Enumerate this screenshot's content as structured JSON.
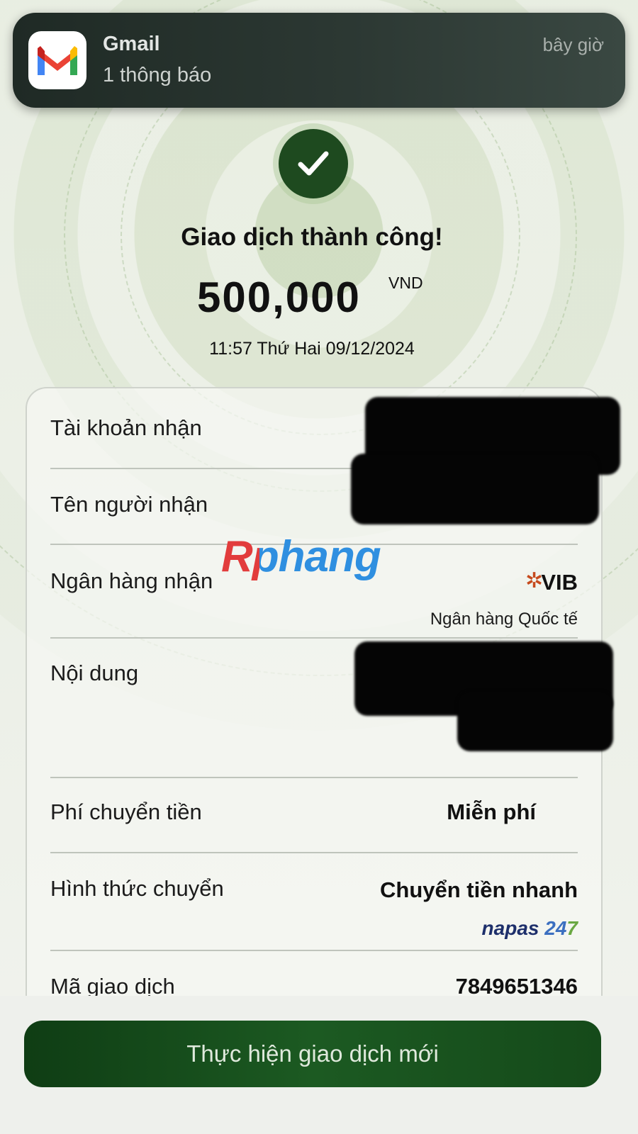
{
  "notification": {
    "app": "Gmail",
    "message": "1 thông báo",
    "time": "bây giờ",
    "icon": "gmail-icon"
  },
  "status": {
    "title": "Giao dịch thành công!",
    "amount": "500,000",
    "currency": "VND",
    "datetime": "11:57 Thứ Hai 09/12/2024",
    "icon": "checkmark-icon"
  },
  "details": {
    "recipient_account_label": "Tài khoản nhận",
    "recipient_name_label": "Tên người nhận",
    "bank_label": "Ngân hàng nhận",
    "bank_code": "VIB",
    "bank_name": "Ngân hàng Quốc tế",
    "content_label": "Nội dung",
    "fee_label": "Phí chuyển tiền",
    "fee_value": "Miễn phí",
    "method_label": "Hình thức chuyển",
    "method_value": "Chuyển tiền nhanh",
    "network_brand": "napas",
    "network_number": "24",
    "network_number_suffix": "7",
    "transaction_id_label": "Mã giao dịch",
    "transaction_id": "7849651346"
  },
  "watermark": "Rphang",
  "actions": {
    "new_transaction": "Thực hiện giao dịch mới"
  },
  "colors": {
    "primary_green": "#1c5a22",
    "check_green": "#1e4a1f"
  }
}
